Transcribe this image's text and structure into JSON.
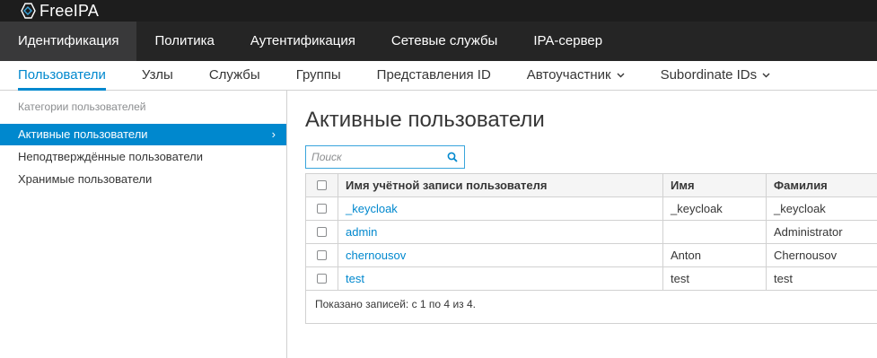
{
  "brand": {
    "name": "FreeIPA"
  },
  "primary_nav": [
    {
      "label": "Идентификация",
      "active": true
    },
    {
      "label": "Политика"
    },
    {
      "label": "Аутентификация"
    },
    {
      "label": "Сетевые службы"
    },
    {
      "label": "IPA-сервер"
    }
  ],
  "secondary_nav": [
    {
      "label": "Пользователи",
      "active": true
    },
    {
      "label": "Узлы"
    },
    {
      "label": "Службы"
    },
    {
      "label": "Группы"
    },
    {
      "label": "Представления ID"
    },
    {
      "label": "Автоучастник",
      "dropdown": true
    },
    {
      "label": "Subordinate IDs",
      "dropdown": true
    }
  ],
  "sidebar": {
    "header": "Категории пользователей",
    "items": [
      {
        "label": "Активные пользователи",
        "active": true,
        "arrow": "›"
      },
      {
        "label": "Неподтверждённые пользователи"
      },
      {
        "label": "Хранимые пользователи"
      }
    ]
  },
  "main": {
    "title": "Активные пользователи",
    "search": {
      "placeholder": "Поиск",
      "value": ""
    },
    "table": {
      "columns": [
        "Имя учётной записи пользователя",
        "Имя",
        "Фамилия"
      ],
      "rows": [
        {
          "login": "_keycloak",
          "first": "_keycloak",
          "last": "_keycloak"
        },
        {
          "login": "admin",
          "first": "",
          "last": "Administrator"
        },
        {
          "login": "chernousov",
          "first": "Anton",
          "last": "Chernousov"
        },
        {
          "login": "test",
          "first": "test",
          "last": "test"
        }
      ],
      "footer": "Показано записей: с 1 по 4 из 4."
    }
  },
  "colors": {
    "accent": "#0088ce",
    "topbar": "#1d1d1d",
    "nav": "#252525",
    "nav_active": "#39393a"
  },
  "icons": {
    "logo": "freeipa-logo-icon",
    "search": "search-icon",
    "dropdown": "chevron-down-icon"
  }
}
